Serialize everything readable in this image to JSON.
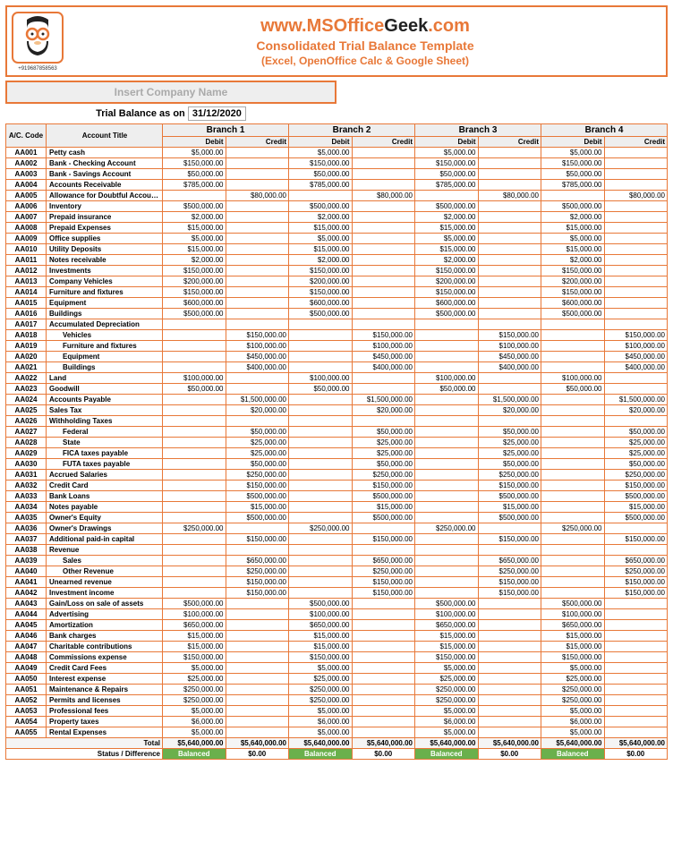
{
  "header": {
    "url_prefix": "www.",
    "url_main": "MSOffice",
    "url_suffix": "Geek",
    "url_tld": ".com",
    "subtitle": "Consolidated Trial Balance Template",
    "subtitle2": "(Excel, OpenOffice Calc & Google Sheet)",
    "phone": "+919687858563"
  },
  "company_placeholder": "Insert Company Name",
  "tb_label": "Trial Balance as on",
  "tb_date": "31/12/2020",
  "branches": [
    "Branch 1",
    "Branch 2",
    "Branch 3",
    "Branch 4"
  ],
  "col_code": "A/C. Code",
  "col_title": "Account Title",
  "col_debit": "Debit",
  "col_credit": "Credit",
  "total_label": "Total",
  "status_label": "Status / Difference",
  "balanced": "Balanced",
  "zero": "$0.00",
  "rows": [
    {
      "code": "AA001",
      "title": "Petty cash",
      "debit": "$5,000.00",
      "credit": ""
    },
    {
      "code": "AA002",
      "title": "Bank - Checking Account",
      "debit": "$150,000.00",
      "credit": ""
    },
    {
      "code": "AA003",
      "title": "Bank - Savings Account",
      "debit": "$50,000.00",
      "credit": ""
    },
    {
      "code": "AA004",
      "title": "Accounts Receivable",
      "debit": "$785,000.00",
      "credit": ""
    },
    {
      "code": "AA005",
      "title": "Allowance for Doubtful Accounts",
      "debit": "",
      "credit": "$80,000.00"
    },
    {
      "code": "AA006",
      "title": "Inventory",
      "debit": "$500,000.00",
      "credit": ""
    },
    {
      "code": "AA007",
      "title": "Prepaid insurance",
      "debit": "$2,000.00",
      "credit": ""
    },
    {
      "code": "AA008",
      "title": "Prepaid Expenses",
      "debit": "$15,000.00",
      "credit": ""
    },
    {
      "code": "AA009",
      "title": "Office supplies",
      "debit": "$5,000.00",
      "credit": ""
    },
    {
      "code": "AA010",
      "title": "Utility Deposits",
      "debit": "$15,000.00",
      "credit": ""
    },
    {
      "code": "AA011",
      "title": "Notes receivable",
      "debit": "$2,000.00",
      "credit": ""
    },
    {
      "code": "AA012",
      "title": "Investments",
      "debit": "$150,000.00",
      "credit": ""
    },
    {
      "code": "AA013",
      "title": "Company Vehicles",
      "debit": "$200,000.00",
      "credit": ""
    },
    {
      "code": "AA014",
      "title": "Furniture and fixtures",
      "debit": "$150,000.00",
      "credit": ""
    },
    {
      "code": "AA015",
      "title": "Equipment",
      "debit": "$600,000.00",
      "credit": ""
    },
    {
      "code": "AA016",
      "title": "Buildings",
      "debit": "$500,000.00",
      "credit": ""
    },
    {
      "code": "AA017",
      "title": "Accumulated Depreciation",
      "debit": "",
      "credit": ""
    },
    {
      "code": "AA018",
      "title": "Vehicles",
      "indent": true,
      "debit": "",
      "credit": "$150,000.00"
    },
    {
      "code": "AA019",
      "title": "Furniture and fixtures",
      "indent": true,
      "debit": "",
      "credit": "$100,000.00"
    },
    {
      "code": "AA020",
      "title": "Equipment",
      "indent": true,
      "debit": "",
      "credit": "$450,000.00"
    },
    {
      "code": "AA021",
      "title": "Buildings",
      "indent": true,
      "debit": "",
      "credit": "$400,000.00"
    },
    {
      "code": "AA022",
      "title": "Land",
      "debit": "$100,000.00",
      "credit": ""
    },
    {
      "code": "AA023",
      "title": "Goodwill",
      "debit": "$50,000.00",
      "credit": ""
    },
    {
      "code": "AA024",
      "title": "Accounts Payable",
      "debit": "",
      "credit": "$1,500,000.00"
    },
    {
      "code": "AA025",
      "title": "Sales Tax",
      "debit": "",
      "credit": "$20,000.00"
    },
    {
      "code": "AA026",
      "title": "Withholding Taxes",
      "debit": "",
      "credit": ""
    },
    {
      "code": "AA027",
      "title": "Federal",
      "indent": true,
      "debit": "",
      "credit": "$50,000.00"
    },
    {
      "code": "AA028",
      "title": "State",
      "indent": true,
      "debit": "",
      "credit": "$25,000.00"
    },
    {
      "code": "AA029",
      "title": "FICA taxes payable",
      "indent": true,
      "debit": "",
      "credit": "$25,000.00"
    },
    {
      "code": "AA030",
      "title": "FUTA taxes payable",
      "indent": true,
      "debit": "",
      "credit": "$50,000.00"
    },
    {
      "code": "AA031",
      "title": "Accrued Salaries",
      "debit": "",
      "credit": "$250,000.00"
    },
    {
      "code": "AA032",
      "title": "Credit Card",
      "debit": "",
      "credit": "$150,000.00"
    },
    {
      "code": "AA033",
      "title": "Bank Loans",
      "debit": "",
      "credit": "$500,000.00"
    },
    {
      "code": "AA034",
      "title": "Notes payable",
      "debit": "",
      "credit": "$15,000.00"
    },
    {
      "code": "AA035",
      "title": "Owner's Equity",
      "debit": "",
      "credit": "$500,000.00"
    },
    {
      "code": "AA036",
      "title": "Owner's Drawings",
      "debit": "$250,000.00",
      "credit": ""
    },
    {
      "code": "AA037",
      "title": "Additional paid-in capital",
      "debit": "",
      "credit": "$150,000.00"
    },
    {
      "code": "AA038",
      "title": "Revenue",
      "debit": "",
      "credit": ""
    },
    {
      "code": "AA039",
      "title": "Sales",
      "indent": true,
      "debit": "",
      "credit": "$650,000.00"
    },
    {
      "code": "AA040",
      "title": "Other Revenue",
      "indent": true,
      "debit": "",
      "credit": "$250,000.00"
    },
    {
      "code": "AA041",
      "title": "Unearned revenue",
      "debit": "",
      "credit": "$150,000.00"
    },
    {
      "code": "AA042",
      "title": "Investment income",
      "debit": "",
      "credit": "$150,000.00"
    },
    {
      "code": "AA043",
      "title": "Gain/Loss on sale of assets",
      "debit": "$500,000.00",
      "credit": ""
    },
    {
      "code": "AA044",
      "title": "Advertising",
      "debit": "$100,000.00",
      "credit": ""
    },
    {
      "code": "AA045",
      "title": "Amortization",
      "debit": "$650,000.00",
      "credit": ""
    },
    {
      "code": "AA046",
      "title": "Bank charges",
      "debit": "$15,000.00",
      "credit": ""
    },
    {
      "code": "AA047",
      "title": "Charitable contributions",
      "debit": "$15,000.00",
      "credit": ""
    },
    {
      "code": "AA048",
      "title": "Commissions expense",
      "debit": "$150,000.00",
      "credit": ""
    },
    {
      "code": "AA049",
      "title": "Credit Card Fees",
      "debit": "$5,000.00",
      "credit": ""
    },
    {
      "code": "AA050",
      "title": "Interest expense",
      "debit": "$25,000.00",
      "credit": ""
    },
    {
      "code": "AA051",
      "title": "Maintenance & Repairs",
      "debit": "$250,000.00",
      "credit": ""
    },
    {
      "code": "AA052",
      "title": "Permits and licenses",
      "debit": "$250,000.00",
      "credit": ""
    },
    {
      "code": "AA053",
      "title": "Professional fees",
      "debit": "$5,000.00",
      "credit": ""
    },
    {
      "code": "AA054",
      "title": "Property taxes",
      "debit": "$6,000.00",
      "credit": ""
    },
    {
      "code": "AA055",
      "title": "Rental Expenses",
      "debit": "$5,000.00",
      "credit": ""
    }
  ],
  "totals": {
    "debit": "$5,640,000.00",
    "credit": "$5,640,000.00"
  }
}
